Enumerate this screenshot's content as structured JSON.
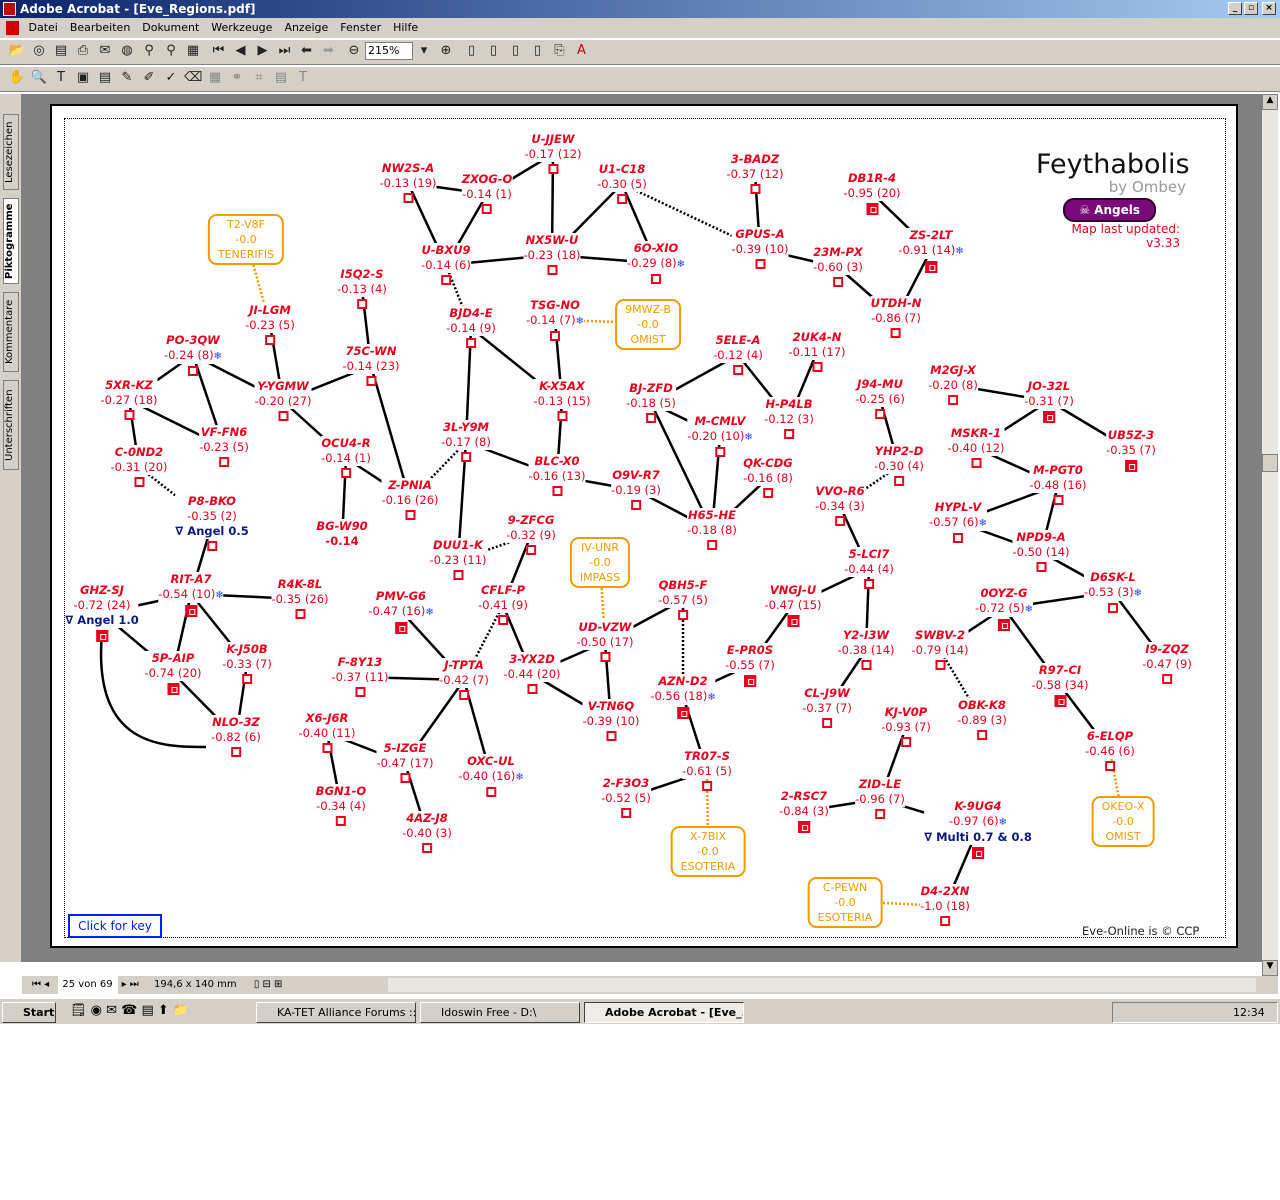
{
  "window": {
    "title": "Adobe Acrobat - [Eve_Regions.pdf]"
  },
  "menu": [
    "Datei",
    "Bearbeiten",
    "Dokument",
    "Werkzeuge",
    "Anzeige",
    "Fenster",
    "Hilfe"
  ],
  "toolbar": {
    "zoom": "215%"
  },
  "side_tabs": [
    "Lesezeichen",
    "Piktogramme",
    "Kommentare",
    "Unterschriften"
  ],
  "status": {
    "page": "25 von 69",
    "size": "194,6 x 140 mm"
  },
  "taskbar": {
    "start": "Start",
    "tasks": [
      "KA-TET Alliance Forums ::...",
      "Idoswin Free - D:\\",
      "Adobe Acrobat - [Eve_..."
    ],
    "clock": "12:34"
  },
  "map": {
    "title": "Feythabolis",
    "author": "by Ombey",
    "faction": "Angels",
    "updated": "Map last updated: v3.33",
    "key_link": "Click for key",
    "copyright": "Eve-Online is © CCP",
    "colors": {
      "system": "#e8001c",
      "constellation": "#f39a00",
      "note": "#0b1a80",
      "faction": "#7a0a7a"
    },
    "nodes": [
      {
        "name": "U-JJEW",
        "info": "-0.17 (12)"
      },
      {
        "name": "NW2S-A",
        "info": "-0.13 (19)"
      },
      {
        "name": "ZXOG-O",
        "info": "-0.14 (1)"
      },
      {
        "name": "U1-C18",
        "info": "-0.30 (5)"
      },
      {
        "name": "3-BADZ",
        "info": "-0.37 (12)"
      },
      {
        "name": "DB1R-4",
        "info": "-0.95 (20)",
        "station": true
      },
      {
        "name": "U-BXU9",
        "info": "-0.14 (6)"
      },
      {
        "name": "NX5W-U",
        "info": "-0.23 (18)"
      },
      {
        "name": "6O-XIO",
        "info": "-0.29 (8)",
        "ice": true
      },
      {
        "name": "GPUS-A",
        "info": "-0.39 (10)"
      },
      {
        "name": "23M-PX",
        "info": "-0.60 (3)"
      },
      {
        "name": "ZS-2LT",
        "info": "-0.91 (14)",
        "ice": true,
        "station": true
      },
      {
        "name": "UTDH-N",
        "info": "-0.86 (7)"
      },
      {
        "name": "I5Q2-S",
        "info": "-0.13 (4)"
      },
      {
        "name": "JI-LGM",
        "info": "-0.23 (5)"
      },
      {
        "name": "BJD4-E",
        "info": "-0.14 (9)"
      },
      {
        "name": "TSG-NO",
        "info": "-0.14 (7)",
        "ice": true
      },
      {
        "name": "PO-3QW",
        "info": "-0.24 (8)",
        "ice": true
      },
      {
        "name": "75C-WN",
        "info": "-0.14 (23)"
      },
      {
        "name": "5ELE-A",
        "info": "-0.12 (4)"
      },
      {
        "name": "2UK4-N",
        "info": "-0.11 (17)"
      },
      {
        "name": "5XR-KZ",
        "info": "-0.27 (18)"
      },
      {
        "name": "Y-YGMW",
        "info": "-0.20 (27)"
      },
      {
        "name": "K-X5AX",
        "info": "-0.13 (15)"
      },
      {
        "name": "BJ-ZFD",
        "info": "-0.18 (5)"
      },
      {
        "name": "H-P4LB",
        "info": "-0.12 (3)"
      },
      {
        "name": "M-CMLV",
        "info": "-0.20 (10)",
        "ice": true
      },
      {
        "name": "J94-MU",
        "info": "-0.25 (6)"
      },
      {
        "name": "M2GJ-X",
        "info": "-0.20 (8)"
      },
      {
        "name": "JO-32L",
        "info": "-0.31 (7)",
        "station": true
      },
      {
        "name": "VF-FN6",
        "info": "-0.23 (5)"
      },
      {
        "name": "OCU4-R",
        "info": "-0.14 (1)"
      },
      {
        "name": "3L-Y9M",
        "info": "-0.17 (8)"
      },
      {
        "name": "BLC-X0",
        "info": "-0.16 (13)"
      },
      {
        "name": "O9V-R7",
        "info": "-0.19 (3)"
      },
      {
        "name": "QK-CDG",
        "info": "-0.16 (8)"
      },
      {
        "name": "YHP2-D",
        "info": "-0.30 (4)"
      },
      {
        "name": "MSKR-1",
        "info": "-0.40 (12)"
      },
      {
        "name": "UB5Z-3",
        "info": "-0.35 (7)",
        "station": true
      },
      {
        "name": "C-0ND2",
        "info": "-0.31 (20)"
      },
      {
        "name": "Z-PNIA",
        "info": "-0.16 (26)"
      },
      {
        "name": "P8-BKO",
        "info": "-0.35 (2)",
        "note": "∇ Angel 0.5"
      },
      {
        "name": "H65-HE",
        "info": "-0.18 (8)"
      },
      {
        "name": "VVO-R6",
        "info": "-0.34 (3)"
      },
      {
        "name": "M-PGT0",
        "info": "-0.48 (16)"
      },
      {
        "name": "HYPL-V",
        "info": "-0.57 (6)",
        "ice": true
      },
      {
        "name": "NPD9-A",
        "info": "-0.50 (14)"
      },
      {
        "name": "BG-W90",
        "info": "-0.14",
        "plain": true
      },
      {
        "name": "9-ZFCG",
        "info": "-0.32 (9)"
      },
      {
        "name": "DUU1-K",
        "info": "-0.23 (11)"
      },
      {
        "name": "5-LCI7",
        "info": "-0.44 (4)"
      },
      {
        "name": "D6SK-L",
        "info": "-0.53 (3)",
        "ice": true
      },
      {
        "name": "GHZ-SJ",
        "info": "-0.72 (24)",
        "note": "∇ Angel 1.0",
        "station": true
      },
      {
        "name": "RIT-A7",
        "info": "-0.54 (10)",
        "ice": true,
        "station": true
      },
      {
        "name": "R4K-8L",
        "info": "-0.35 (26)"
      },
      {
        "name": "PMV-G6",
        "info": "-0.47 (16)",
        "ice": true,
        "station": true
      },
      {
        "name": "CFLF-P",
        "info": "-0.41 (9)"
      },
      {
        "name": "QBH5-F",
        "info": "-0.57 (5)"
      },
      {
        "name": "VNGJ-U",
        "info": "-0.47 (15)",
        "station": true
      },
      {
        "name": "0OYZ-G",
        "info": "-0.72 (5)",
        "ice": true,
        "station": true
      },
      {
        "name": "UD-VZW",
        "info": "-0.50 (17)"
      },
      {
        "name": "I9-ZQZ",
        "info": "-0.47 (9)"
      },
      {
        "name": "K-J50B",
        "info": "-0.33 (7)"
      },
      {
        "name": "5P-AIP",
        "info": "-0.74 (20)",
        "station": true
      },
      {
        "name": "F-8Y13",
        "info": "-0.37 (11)"
      },
      {
        "name": "J-TPTA",
        "info": "-0.42 (7)"
      },
      {
        "name": "3-YX2D",
        "info": "-0.44 (20)"
      },
      {
        "name": "E-PR0S",
        "info": "-0.55 (7)",
        "station": true
      },
      {
        "name": "Y2-I3W",
        "info": "-0.38 (14)"
      },
      {
        "name": "SWBV-2",
        "info": "-0.79 (14)"
      },
      {
        "name": "R97-CI",
        "info": "-0.58 (34)",
        "station": true
      },
      {
        "name": "AZN-D2",
        "info": "-0.56 (18)",
        "ice": true,
        "station": true
      },
      {
        "name": "CL-J9W",
        "info": "-0.37 (7)"
      },
      {
        "name": "V-TN6Q",
        "info": "-0.39 (10)"
      },
      {
        "name": "OBK-K8",
        "info": "-0.89 (3)"
      },
      {
        "name": "KJ-V0P",
        "info": "-0.93 (7)"
      },
      {
        "name": "NLO-3Z",
        "info": "-0.82 (6)"
      },
      {
        "name": "X6-J6R",
        "info": "-0.40 (11)"
      },
      {
        "name": "5-IZGE",
        "info": "-0.47 (17)"
      },
      {
        "name": "OXC-UL",
        "info": "-0.40 (16)",
        "ice": true
      },
      {
        "name": "6-ELQP",
        "info": "-0.46 (6)"
      },
      {
        "name": "TR07-S",
        "info": "-0.61 (5)"
      },
      {
        "name": "ZID-LE",
        "info": "-0.96 (7)"
      },
      {
        "name": "2-F3O3",
        "info": "-0.52 (5)"
      },
      {
        "name": "BGN1-O",
        "info": "-0.34 (4)"
      },
      {
        "name": "2-RSC7",
        "info": "-0.84 (3)",
        "station": true
      },
      {
        "name": "K-9UG4",
        "info": "-0.97 (6)",
        "ice": true,
        "note": "∇ Multi 0.7 & 0.8",
        "station": true
      },
      {
        "name": "4AZ-J8",
        "info": "-0.40 (3)"
      },
      {
        "name": "D4-2XN",
        "info": "-1.0 (18)"
      }
    ],
    "constellations": [
      {
        "name": "T2-V8F",
        "sec": "-0.0",
        "region": "TENERIFIS"
      },
      {
        "name": "9MWZ-B",
        "sec": "-0.0",
        "region": "OMIST"
      },
      {
        "name": "IV-UNR",
        "sec": "-0.0",
        "region": "IMPASS"
      },
      {
        "name": "OKEO-X",
        "sec": "-0.0",
        "region": "OMIST"
      },
      {
        "name": "X-7BIX",
        "sec": "-0.0",
        "region": "ESOTERIA"
      },
      {
        "name": "C-PEWN",
        "sec": "-0.0",
        "region": "ESOTERIA"
      }
    ],
    "edges": [
      [
        "NW2S-A",
        "ZXOG-O"
      ],
      [
        "NW2S-A",
        "U-BXU9"
      ],
      [
        "ZXOG-O",
        "U-BXU9"
      ],
      [
        "ZXOG-O",
        "U-JJEW"
      ],
      [
        "U-JJEW",
        "NX5W-U"
      ],
      [
        "NX5W-U",
        "U-BXU9"
      ],
      [
        "NX5W-U",
        "U1-C18"
      ],
      [
        "NX5W-U",
        "6O-XIO"
      ],
      [
        "U1-C18",
        "6O-XIO"
      ],
      [
        "U1-C18",
        "GPUS-A",
        "d"
      ],
      [
        "3-BADZ",
        "GPUS-A"
      ],
      [
        "GPUS-A",
        "23M-PX"
      ],
      [
        "23M-PX",
        "UTDH-N"
      ],
      [
        "DB1R-4",
        "ZS-2LT"
      ],
      [
        "ZS-2LT",
        "UTDH-N"
      ],
      [
        "U-BXU9",
        "BJD4-E",
        "d"
      ],
      [
        "BJD4-E",
        "K-X5AX"
      ],
      [
        "BJD4-E",
        "3L-Y9M"
      ],
      [
        "TSG-NO",
        "K-X5AX"
      ],
      [
        "K-X5AX",
        "BLC-X0"
      ],
      [
        "3L-Y9M",
        "BLC-X0"
      ],
      [
        "3L-Y9M",
        "Z-PNIA",
        "d"
      ],
      [
        "3L-Y9M",
        "DUU1-K"
      ],
      [
        "BLC-X0",
        "O9V-R7"
      ],
      [
        "O9V-R7",
        "H65-HE"
      ],
      [
        "BJ-ZFD",
        "5ELE-A"
      ],
      [
        "BJ-ZFD",
        "H65-HE"
      ],
      [
        "BJ-ZFD",
        "M-CMLV"
      ],
      [
        "5ELE-A",
        "H-P4LB"
      ],
      [
        "2UK4-N",
        "H-P4LB"
      ],
      [
        "M-CMLV",
        "H65-HE"
      ],
      [
        "QK-CDG",
        "H65-HE"
      ],
      [
        "JI-LGM",
        "Y-YGMW"
      ],
      [
        "I5Q2-S",
        "75C-WN"
      ],
      [
        "75C-WN",
        "Y-YGMW"
      ],
      [
        "75C-WN",
        "Z-PNIA"
      ],
      [
        "PO-3QW",
        "5XR-KZ"
      ],
      [
        "PO-3QW",
        "Y-YGMW"
      ],
      [
        "PO-3QW",
        "VF-FN6"
      ],
      [
        "5XR-KZ",
        "VF-FN6"
      ],
      [
        "5XR-KZ",
        "C-0ND2"
      ],
      [
        "C-0ND2",
        "P8-BKO",
        "d"
      ],
      [
        "Y-YGMW",
        "OCU4-R"
      ],
      [
        "OCU4-R",
        "Z-PNIA"
      ],
      [
        "OCU4-R",
        "BG-W90"
      ],
      [
        "P8-BKO",
        "RIT-A7"
      ],
      [
        "RIT-A7",
        "GHZ-SJ"
      ],
      [
        "RIT-A7",
        "R4K-8L"
      ],
      [
        "RIT-A7",
        "5P-AIP"
      ],
      [
        "RIT-A7",
        "K-J50B"
      ],
      [
        "GHZ-SJ",
        "5P-AIP"
      ],
      [
        "GHZ-SJ",
        "NLO-3Z"
      ],
      [
        "5P-AIP",
        "NLO-3Z"
      ],
      [
        "K-J50B",
        "NLO-3Z"
      ],
      [
        "DUU1-K",
        "9-ZFCG",
        "d"
      ],
      [
        "9-ZFCG",
        "CFLF-P"
      ],
      [
        "CFLF-P",
        "J-TPTA",
        "d"
      ],
      [
        "CFLF-P",
        "3-YX2D"
      ],
      [
        "PMV-G6",
        "J-TPTA"
      ],
      [
        "F-8Y13",
        "J-TPTA"
      ],
      [
        "J-TPTA",
        "5-IZGE"
      ],
      [
        "J-TPTA",
        "OXC-UL"
      ],
      [
        "X6-J6R",
        "5-IZGE"
      ],
      [
        "X6-J6R",
        "BGN1-O"
      ],
      [
        "5-IZGE",
        "4AZ-J8"
      ],
      [
        "3-YX2D",
        "UD-VZW"
      ],
      [
        "3-YX2D",
        "V-TN6Q"
      ],
      [
        "UD-VZW",
        "QBH5-F"
      ],
      [
        "UD-VZW",
        "V-TN6Q"
      ],
      [
        "QBH5-F",
        "AZN-D2",
        "d"
      ],
      [
        "AZN-D2",
        "E-PR0S"
      ],
      [
        "E-PR0S",
        "VNGJ-U"
      ],
      [
        "VNGJ-U",
        "5-LCI7"
      ],
      [
        "5-LCI7",
        "VVO-R6"
      ],
      [
        "5-LCI7",
        "Y2-I3W"
      ],
      [
        "Y2-I3W",
        "CL-J9W"
      ],
      [
        "VVO-R6",
        "YHP2-D",
        "d"
      ],
      [
        "YHP2-D",
        "J94-MU"
      ],
      [
        "M2GJ-X",
        "JO-32L"
      ],
      [
        "JO-32L",
        "MSKR-1"
      ],
      [
        "JO-32L",
        "UB5Z-3"
      ],
      [
        "MSKR-1",
        "M-PGT0"
      ],
      [
        "M-PGT0",
        "HYPL-V"
      ],
      [
        "M-PGT0",
        "NPD9-A"
      ],
      [
        "HYPL-V",
        "NPD9-A"
      ],
      [
        "NPD9-A",
        "D6SK-L"
      ],
      [
        "D6SK-L",
        "0OYZ-G"
      ],
      [
        "D6SK-L",
        "I9-ZQZ"
      ],
      [
        "0OYZ-G",
        "SWBV-2"
      ],
      [
        "0OYZ-G",
        "R97-CI"
      ],
      [
        "SWBV-2",
        "OBK-K8",
        "d"
      ],
      [
        "R97-CI",
        "6-ELQP"
      ],
      [
        "KJ-V0P",
        "ZID-LE"
      ],
      [
        "ZID-LE",
        "2-RSC7"
      ],
      [
        "ZID-LE",
        "K-9UG4"
      ],
      [
        "K-9UG4",
        "D4-2XN"
      ],
      [
        "TR07-S",
        "AZN-D2"
      ],
      [
        "TR07-S",
        "2-F3O3"
      ],
      [
        "T2-V8F",
        "JI-LGM",
        "c"
      ],
      [
        "TSG-NO",
        "9MWZ-B",
        "c"
      ],
      [
        "UD-VZW",
        "IV-UNR",
        "c"
      ],
      [
        "6-ELQP",
        "OKEO-X",
        "c"
      ],
      [
        "TR07-S",
        "X-7BIX",
        "c"
      ],
      [
        "D4-2XN",
        "C-PEWN",
        "c"
      ]
    ]
  }
}
